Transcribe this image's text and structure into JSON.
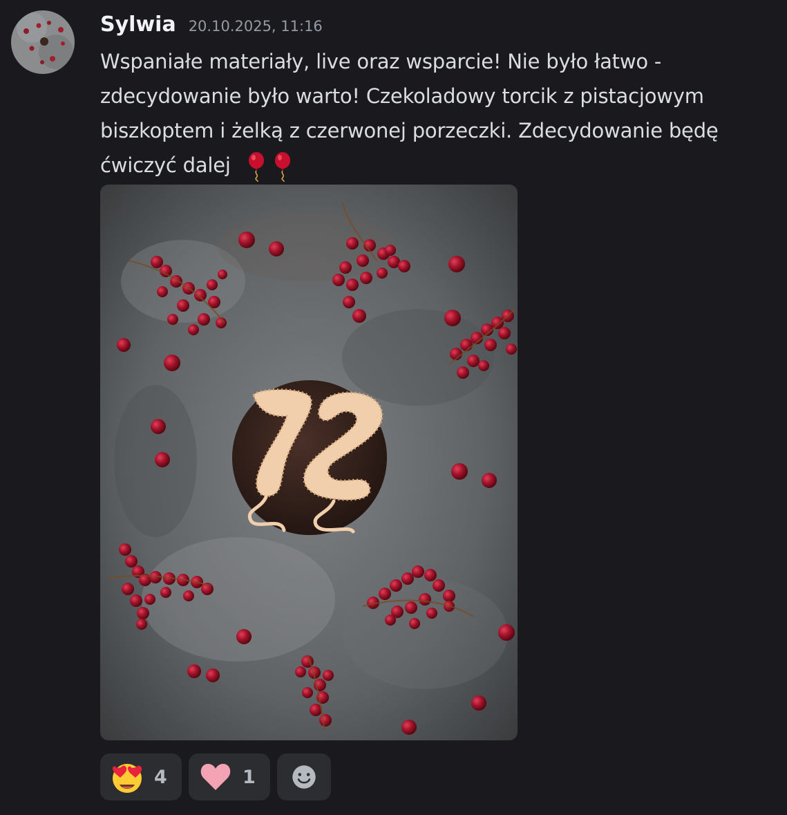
{
  "message": {
    "author": "Sylwia",
    "timestamp": "20.10.2025, 11:16",
    "lines": [
      "Wspaniałe materiały, live oraz wsparcie! Nie było łatwo -",
      "zdecydowanie było warto! Czekoladowy torcik z pistacjowym",
      "biszkoptem i żelką z czerwonej porzeczki. Zdecydowanie będę",
      "ćwiczyć dalej"
    ],
    "trailing_emoji": [
      "balloon-icon",
      "balloon-icon"
    ]
  },
  "attachment": {
    "type": "image",
    "depicts": "chocolate cake with number 72 balloon decoration and red currants"
  },
  "reactions": [
    {
      "emoji": "heart-eyes-face-icon",
      "count": "4"
    },
    {
      "emoji": "pink-heart-icon",
      "count": "1"
    }
  ],
  "add_reaction": {
    "icon": "smiley-add-icon"
  },
  "colors": {
    "background": "#1a1a1e",
    "reaction_bg": "#2b2d31",
    "username": "#f2f3f5",
    "timestamp": "#949ba4",
    "text": "#dbdee1"
  }
}
